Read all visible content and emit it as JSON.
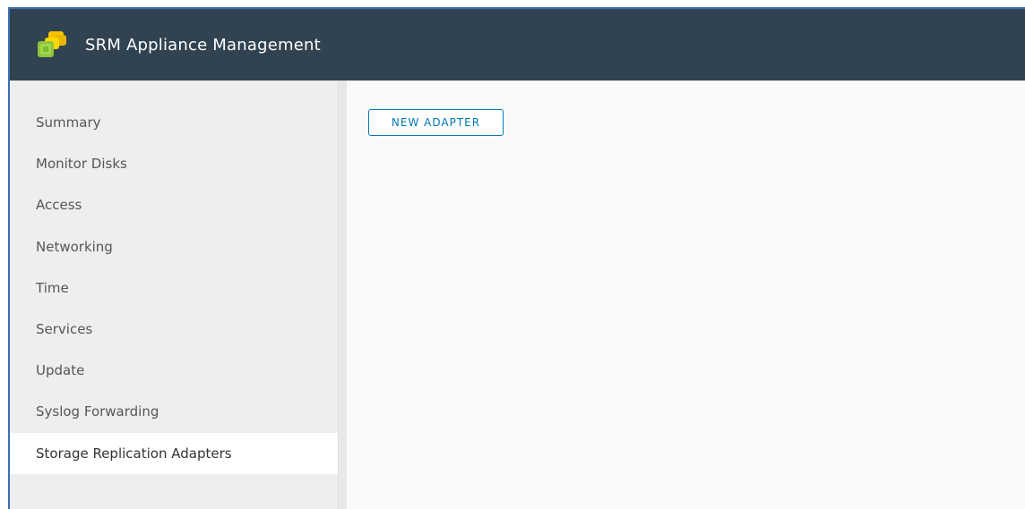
{
  "header": {
    "title": "SRM Appliance Management",
    "logo_icon": "vmware-srm-logo-icon",
    "background_color": "#314351"
  },
  "sidebar": {
    "items": [
      {
        "label": "Summary",
        "active": false
      },
      {
        "label": "Monitor Disks",
        "active": false
      },
      {
        "label": "Access",
        "active": false
      },
      {
        "label": "Networking",
        "active": false
      },
      {
        "label": "Time",
        "active": false
      },
      {
        "label": "Services",
        "active": false
      },
      {
        "label": "Update",
        "active": false
      },
      {
        "label": "Syslog Forwarding",
        "active": false
      },
      {
        "label": "Storage Replication Adapters",
        "active": true
      }
    ]
  },
  "main": {
    "new_adapter_label": "NEW ADAPTER",
    "accent_color": "#0079b8"
  }
}
